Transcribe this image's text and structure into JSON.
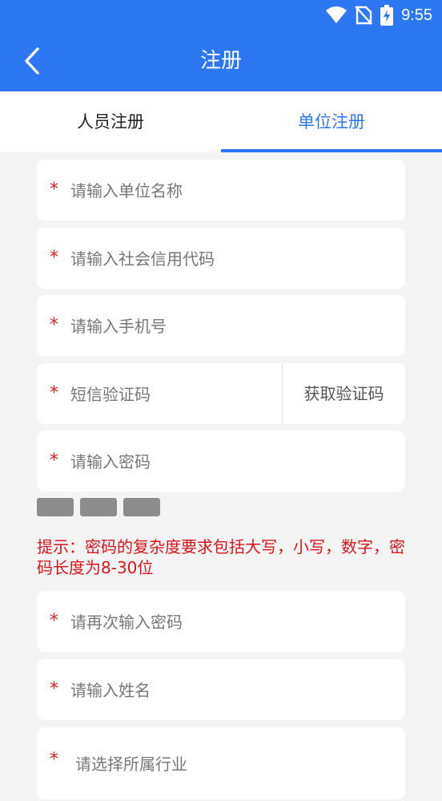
{
  "status_bar": {
    "time": "9:55",
    "icons": [
      "wifi-icon",
      "no-sim-icon",
      "battery-charging-icon"
    ]
  },
  "header": {
    "title": "注册",
    "back_icon": "chevron-left-icon"
  },
  "colors": {
    "primary": "#2e77f2",
    "required": "#e02020",
    "hint": "#d8151a"
  },
  "tabs": [
    {
      "label": "人员注册",
      "active": false
    },
    {
      "label": "单位注册",
      "active": true
    }
  ],
  "form": {
    "org_name": {
      "placeholder": "请输入单位名称",
      "value": ""
    },
    "credit_code": {
      "placeholder": "请输入社会信用代码",
      "value": ""
    },
    "phone": {
      "placeholder": "请输入手机号",
      "value": ""
    },
    "sms_code": {
      "placeholder": "短信验证码",
      "value": ""
    },
    "sms_button": "获取验证码",
    "password": {
      "placeholder": "请输入密码",
      "value": ""
    },
    "password_strength_level": 0,
    "password_hint": "提示：密码的复杂度要求包括大写，小写，数字，密码长度为8-30位",
    "confirm_password": {
      "placeholder": "请再次输入密码",
      "value": ""
    },
    "name": {
      "placeholder": "请输入姓名",
      "value": ""
    },
    "industry": {
      "placeholder": "请选择所属行业"
    },
    "required_mark": "*"
  }
}
